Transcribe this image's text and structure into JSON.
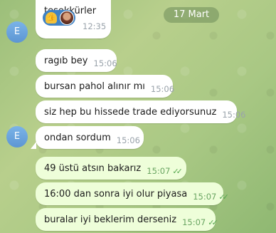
{
  "date_chip": "17 Mart",
  "avatar_initial": "E",
  "messages": [
    {
      "text": "teşekkürler",
      "time": "12:35",
      "reactions": [
        "thumbs-up",
        "avatar"
      ]
    },
    {
      "text": "ragıb bey",
      "time": "15:06"
    },
    {
      "text": "bursan pahol alınır mı",
      "time": "15:06"
    },
    {
      "text": "siz hep bu hissede trade ediyorsunuz",
      "time": "15:06"
    },
    {
      "text": "ondan sordum",
      "time": "15:06"
    },
    {
      "text": "49 üstü atsın bakarız",
      "time": "15:07",
      "read_ticks": "✓✓"
    },
    {
      "text": "16:00 dan sonra iyi olur piyasa",
      "time": "15:07",
      "read_ticks": "✓✓"
    },
    {
      "text": "buralar iyi beklerim derseniz",
      "time": "15:07",
      "read_ticks": "✓✓"
    }
  ],
  "colors": {
    "incoming_bubble": "#ffffff",
    "outgoing_bubble": "#eefed9",
    "avatar": "#6aa4de",
    "ticks": "#55a84f"
  }
}
